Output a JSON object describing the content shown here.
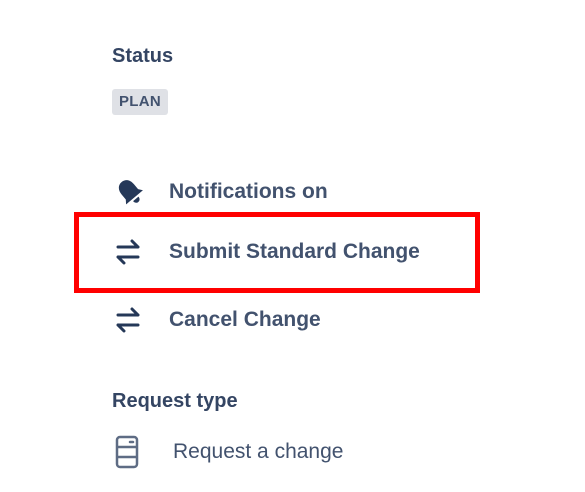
{
  "status": {
    "heading": "Status",
    "value": "PLAN"
  },
  "actions": {
    "notifications_label": "Notifications on",
    "submit_label": "Submit Standard Change",
    "cancel_label": "Cancel Change"
  },
  "request_type": {
    "heading": "Request type",
    "value": "Request a change"
  },
  "icons": {
    "notifications": "bell-icon",
    "submit": "transition-arrows-icon",
    "cancel": "transition-arrows-icon",
    "request_type": "change-request-icon"
  },
  "colors": {
    "text": "#42526e",
    "heading": "#344563",
    "lozenge_bg": "#dfe1e6",
    "highlight": "#ff0000"
  }
}
